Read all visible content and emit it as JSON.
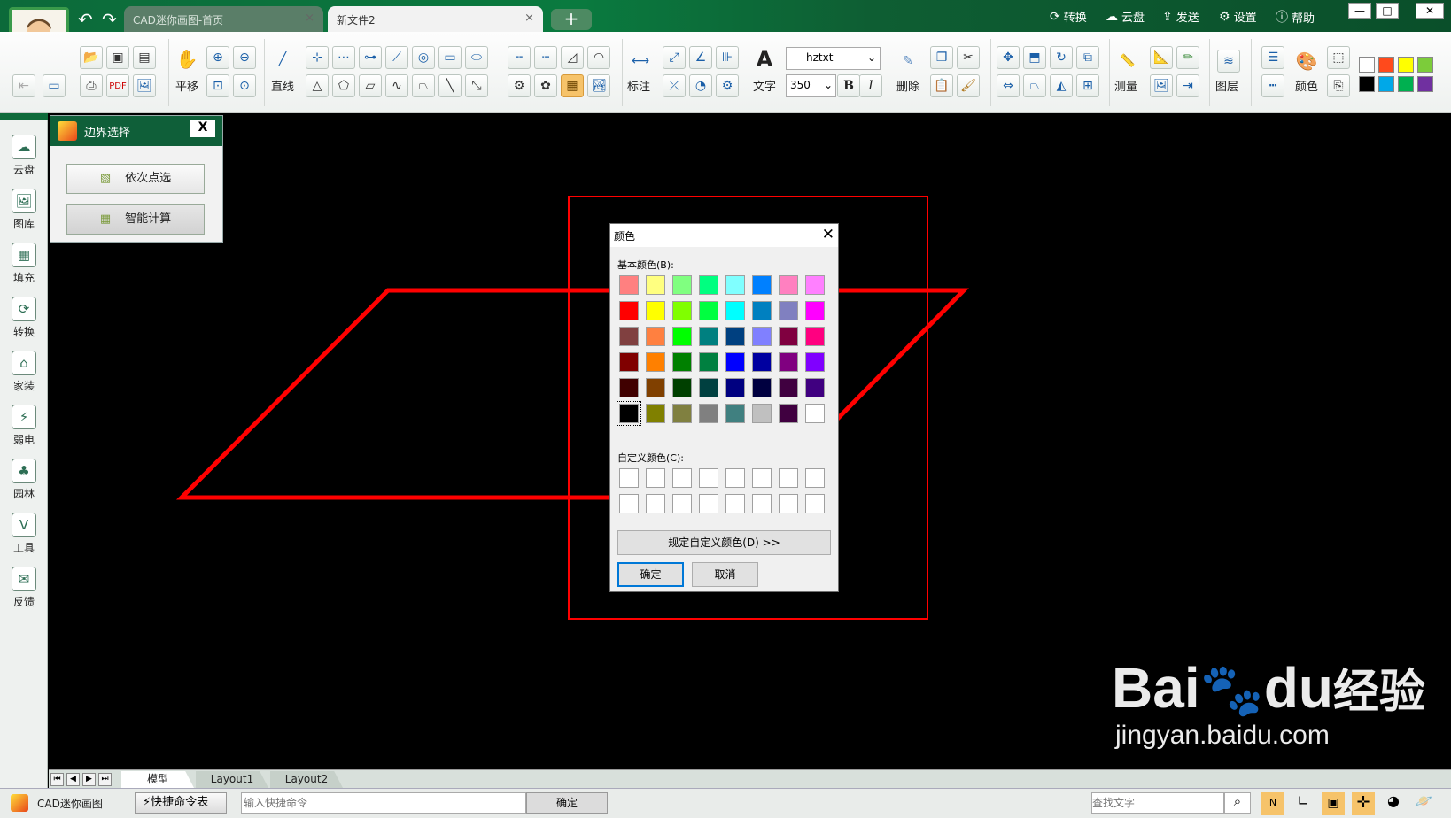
{
  "tabs": {
    "home": "CAD迷你画图-首页",
    "current": "新文件2",
    "add": "+"
  },
  "topmenu": {
    "convert": "转换",
    "cloud": "云盘",
    "send": "发送",
    "settings": "设置",
    "help": "帮助"
  },
  "toolbar": {
    "pan": "平移",
    "line": "直线",
    "annotate": "标注",
    "text": "文字",
    "font": "hztxt",
    "size": "350",
    "bold": "B",
    "italic": "I",
    "delete": "删除",
    "measure": "测量",
    "layer": "图层",
    "color": "颜色"
  },
  "palette": [
    "#ffffff",
    "#ff4a1c",
    "#ffff00",
    "#7ccc3a",
    "#000000",
    "#00a8e8",
    "#00b050",
    "#7030a0"
  ],
  "sidebar": [
    {
      "label": "云盘",
      "icon": "cloud-icon"
    },
    {
      "label": "图库",
      "icon": "image-icon"
    },
    {
      "label": "填充",
      "icon": "hatch-icon"
    },
    {
      "label": "转换",
      "icon": "convert-icon"
    },
    {
      "label": "家装",
      "icon": "home-icon"
    },
    {
      "label": "弱电",
      "icon": "electric-icon"
    },
    {
      "label": "园林",
      "icon": "tree-icon"
    },
    {
      "label": "工具",
      "icon": "tool-icon"
    },
    {
      "label": "反馈",
      "icon": "mail-icon"
    }
  ],
  "boundary_panel": {
    "title": "边界选择",
    "close": "X",
    "pick": "依次点选",
    "smart": "智能计算"
  },
  "color_dialog": {
    "title": "颜色",
    "basic_label": "基本颜色(B):",
    "custom_label": "自定义颜色(C):",
    "define_button": "规定自定义颜色(D) >>",
    "ok": "确定",
    "cancel": "取消",
    "basic_colors": [
      "#ff8080",
      "#ffff80",
      "#80ff80",
      "#00ff80",
      "#80ffff",
      "#0080ff",
      "#ff80c0",
      "#ff80ff",
      "#ff0000",
      "#ffff00",
      "#80ff00",
      "#00ff40",
      "#00ffff",
      "#0080c0",
      "#8080c0",
      "#ff00ff",
      "#804040",
      "#ff8040",
      "#00ff00",
      "#008080",
      "#004080",
      "#8080ff",
      "#800040",
      "#ff0080",
      "#800000",
      "#ff8000",
      "#008000",
      "#008040",
      "#0000ff",
      "#0000a0",
      "#800080",
      "#8000ff",
      "#400000",
      "#804000",
      "#004000",
      "#004040",
      "#000080",
      "#000040",
      "#400040",
      "#400080",
      "#000000",
      "#808000",
      "#808040",
      "#808080",
      "#408080",
      "#c0c0c0",
      "#400040",
      "#ffffff"
    ],
    "selected_index": 40
  },
  "layouts": {
    "model": "模型",
    "layout1": "Layout1",
    "layout2": "Layout2"
  },
  "status": {
    "app": "CAD迷你画图",
    "shortcut": "快捷命令表",
    "command_placeholder": "输入快捷命令",
    "confirm": "确定",
    "search_placeholder": "查找文字"
  },
  "watermark": {
    "brand": "Bai",
    "brand2": "du",
    "brand3": "经验",
    "url": "jingyan.baidu.com"
  },
  "colors": {
    "drawing_red": "#ff0000",
    "accent_green": "#0e6a3a"
  }
}
